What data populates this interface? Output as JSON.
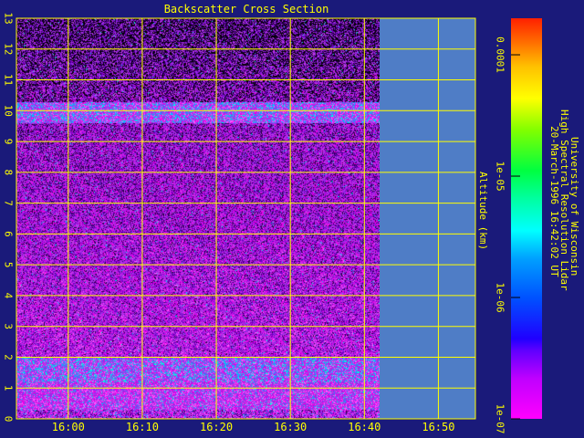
{
  "chart_data": {
    "type": "heatmap",
    "title": "Backscatter Cross Section",
    "xlabel": "",
    "ylabel": "Altitude (km)",
    "x_ticks": [
      "16:00",
      "16:10",
      "16:20",
      "16:30",
      "16:40",
      "16:50"
    ],
    "x_range_minutes": [
      -7,
      55
    ],
    "x_data_end_minutes": 42,
    "y_ticks": [
      "0",
      "1",
      "2",
      "3",
      "4",
      "5",
      "6",
      "7",
      "8",
      "9",
      "10",
      "11",
      "12",
      "13"
    ],
    "ylim": [
      0,
      13
    ],
    "colorbar": {
      "scale": "log",
      "range": [
        1e-07,
        0.0002
      ],
      "ticks": [
        "0.0001",
        "1e-05",
        "1e-06",
        "1e-07"
      ],
      "tick_values": [
        0.0001,
        1e-05,
        1e-06,
        1e-07
      ]
    },
    "features": [
      {
        "name": "cloud layer",
        "altitude_km": 10.0
      },
      {
        "name": "boundary layer",
        "altitude_km": [
          0.5,
          2.0
        ]
      }
    ]
  },
  "credit_lines": [
    "University of Wisconsin",
    "High Spectral Resolution Lidar",
    "20-March-1996 16:42:02 UT"
  ],
  "colors": {
    "background": "#1a1a7a",
    "axes": "#ffff00",
    "no_data": "#4f7dc6"
  }
}
